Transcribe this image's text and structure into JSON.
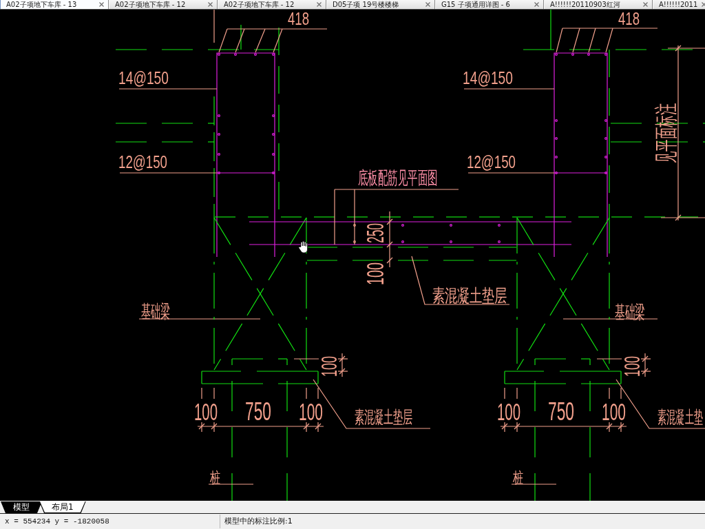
{
  "document_tabs": [
    {
      "label": "A02子项地下车库 - 13",
      "selected": true
    },
    {
      "label": "A02子项地下车库 - 12",
      "selected": false
    },
    {
      "label": "A02子项地下车库 - 12",
      "selected": false
    },
    {
      "label": "D05子项 19号楼楼梯",
      "selected": false
    },
    {
      "label": "G15 子项通用详图 - 6",
      "selected": false
    },
    {
      "label": "A!!!!!!20110903红河",
      "selected": false
    },
    {
      "label": "A!!!!!!2011",
      "selected": false
    }
  ],
  "drawing": {
    "left_section": {
      "rebar_count": "418",
      "outer_rebar": "14@150",
      "inner_rebar": "12@150",
      "beam_label": "基础梁",
      "cap_thickness": "100",
      "footing_widths": [
        "100",
        "750",
        "100"
      ],
      "bedding_label": "素混凝土垫层",
      "pile_label": "桩"
    },
    "slab": {
      "rebar_note": "底板配筋见平面图",
      "slab_thickness": "250",
      "bedding_thickness": "100",
      "bedding_label": "素混凝土垫层"
    },
    "right_section": {
      "rebar_count": "418",
      "outer_rebar": "14@150",
      "inner_rebar": "12@150",
      "elevation_note": "见平面标注",
      "beam_label": "基础梁",
      "cap_thickness": "100",
      "footing_widths": [
        "100",
        "750",
        "100"
      ],
      "bedding_label": "素混凝土垫",
      "pile_label": "桩"
    }
  },
  "layout_tabs": [
    {
      "label": "模型",
      "selected": true
    },
    {
      "label": "布局1",
      "selected": false
    }
  ],
  "status_bar": {
    "coordinates": "x = 554234 y = -1820058",
    "annotation_scale": "模型中的标注比例:1"
  }
}
